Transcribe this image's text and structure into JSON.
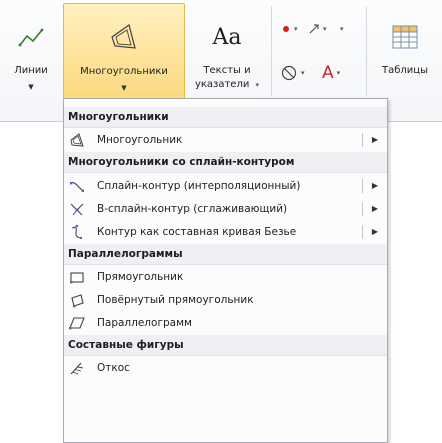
{
  "ribbon": {
    "lines_label": "Линии",
    "polygons_label": "Многоугольники",
    "texts_label_1": "Тексты и",
    "texts_label_2": "указатели",
    "texts_glyph": "Aa",
    "tables_label": "Таблицы",
    "caret": "▼",
    "small_caret": "▾",
    "colors": {
      "polygons_highlight": "#fcd97f",
      "marker_red": "#d81e1e",
      "letter_a_red": "#c62828"
    }
  },
  "menu": {
    "sections": [
      {
        "title": "Многоугольники",
        "items": [
          {
            "label": "Многоугольник",
            "icon": "polygon-icon",
            "submenu": true
          }
        ]
      },
      {
        "title": "Многоугольники со сплайн-контуром",
        "items": [
          {
            "label": "Сплайн-контур (интерполяционный)",
            "icon": "interpolation-spline-icon",
            "submenu": true
          },
          {
            "label": "B-сплайн-контур (сглаживающий)",
            "icon": "b-spline-icon",
            "submenu": true
          },
          {
            "label": "Контур как составная кривая Безье",
            "icon": "bezier-curve-icon",
            "submenu": true
          }
        ]
      },
      {
        "title": "Параллелограммы",
        "items": [
          {
            "label": "Прямоугольник",
            "icon": "rectangle-icon",
            "submenu": false
          },
          {
            "label": "Повёрнутый прямоугольник",
            "icon": "rotated-rectangle-icon",
            "submenu": false
          },
          {
            "label": "Параллелограмм",
            "icon": "parallelogram-icon",
            "submenu": false
          }
        ]
      },
      {
        "title": "Составные фигуры",
        "items": [
          {
            "label": "Откос",
            "icon": "slope-icon",
            "submenu": false
          }
        ]
      }
    ],
    "submenu_arrow": "▶"
  }
}
